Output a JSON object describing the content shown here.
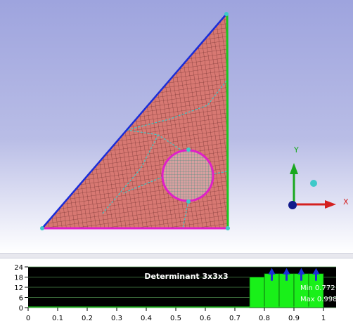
{
  "viewport": {
    "background_top": "#9ea4de",
    "mesh_fill": "#d77872",
    "mesh_line": "#5a1f1f",
    "edge_hypotenuse_color": "#1a2dd8",
    "edge_vertical_color": "#19c91e",
    "edge_bottom_color": "#e020c8",
    "hole_edge_color": "#e020c8",
    "block_edge_color": "#3ec9c9"
  },
  "triad": {
    "y_label": "Y",
    "x_label": "X",
    "y_color": "#19a81e",
    "x_color": "#d42020",
    "z_color": "#111a8a"
  },
  "histogram": {
    "title": "Determinant 3x3x3",
    "min_label": "Min 0.772",
    "max_label": "Max 0.998",
    "y_ticks": [
      "24",
      "18",
      "12",
      "6",
      "0"
    ],
    "x_ticks": [
      "0",
      "0.1",
      "0.2",
      "0.3",
      "0.4",
      "0.5",
      "0.6",
      "0.7",
      "0.8",
      "0.9",
      "1"
    ],
    "bar_color": "#19f019",
    "background": "#000000"
  },
  "chart_data": {
    "type": "bar",
    "title": "Determinant 3x3x3",
    "xlim": [
      0,
      1
    ],
    "ylim": [
      0,
      24
    ],
    "bins": [
      {
        "from": 0.75,
        "to": 0.8,
        "value": 18
      },
      {
        "from": 0.8,
        "to": 0.85,
        "value": 20
      },
      {
        "from": 0.85,
        "to": 0.9,
        "value": 20
      },
      {
        "from": 0.9,
        "to": 0.95,
        "value": 20
      },
      {
        "from": 0.95,
        "to": 1.0,
        "value": 20
      }
    ]
  }
}
